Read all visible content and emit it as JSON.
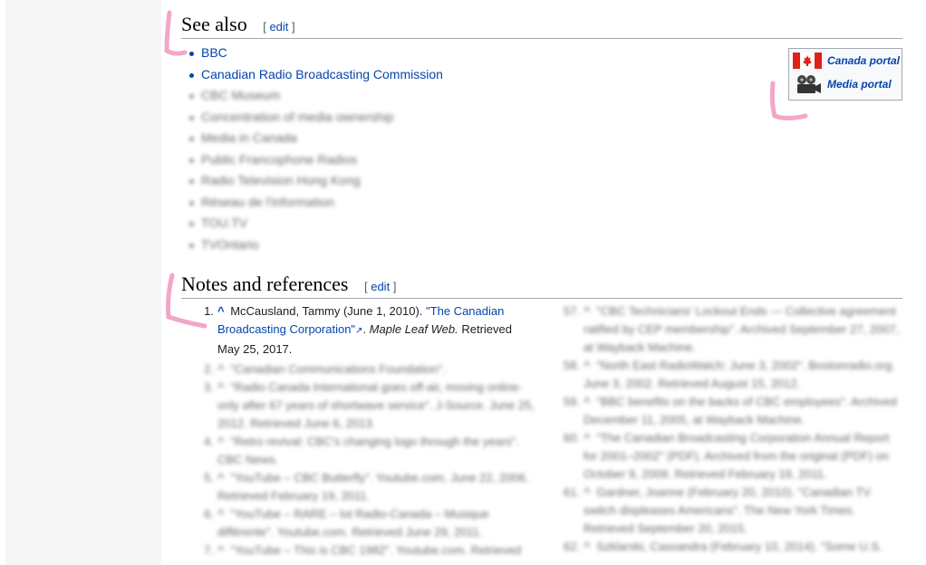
{
  "see_also": {
    "title": "See also",
    "edit_open": "[",
    "edit_label": "edit",
    "edit_close": "]",
    "items": [
      {
        "label": "BBC",
        "blurred": false
      },
      {
        "label": "Canadian Radio Broadcasting Commission",
        "blurred": false
      },
      {
        "label": "CBC Museum",
        "blurred": true
      },
      {
        "label": "Concentration of media ownership",
        "blurred": true
      },
      {
        "label": "Media in Canada",
        "blurred": true
      },
      {
        "label": "Public Francophone Radios",
        "blurred": true
      },
      {
        "label": "Radio Television Hong Kong",
        "blurred": true
      },
      {
        "label": "Réseau de l'information",
        "blurred": true
      },
      {
        "label": "TOU.TV",
        "blurred": true
      },
      {
        "label": "TVOntario",
        "blurred": true
      }
    ]
  },
  "portals": [
    {
      "label": "Canada portal",
      "icon": "canada-flag-icon"
    },
    {
      "label": "Media portal",
      "icon": "film-camera-icon"
    }
  ],
  "notes": {
    "title": "Notes and references",
    "edit_open": "[",
    "edit_label": "edit",
    "edit_close": "]",
    "first_ref": {
      "number": "1.",
      "caret": "^",
      "author": "McCausland, Tammy (June 1, 2010).",
      "title_link": "\"The Canadian Broadcasting Corporation\"",
      "source": "Maple Leaf Web.",
      "retrieved": "Retrieved May 25, 2017."
    },
    "left_blurred": [
      {
        "number": "2.",
        "text": "\"Canadian Communications Foundation\"."
      },
      {
        "number": "3.",
        "text": "\"Radio Canada International goes off-air, moving online-only after 67 years of shortwave service\". J-Source. June 25, 2012. Retrieved June 6, 2013."
      },
      {
        "number": "4.",
        "text": "\"Retro revival: CBC's changing logo through the years\". CBC News."
      },
      {
        "number": "5.",
        "text": "\"YouTube – CBC Butterfly\". Youtube.com. June 22, 2006. Retrieved February 19, 2011."
      },
      {
        "number": "6.",
        "text": "\"YouTube – RARE – lot Radio-Canada – Musique différente\". Youtube.com. Retrieved June 29, 2011."
      },
      {
        "number": "7.",
        "text": "\"YouTube – This is CBC 1982\". Youtube.com. Retrieved"
      }
    ],
    "right_blurred": [
      {
        "number": "57.",
        "text": "\"CBC Technicians' Lockout Ends — Collective agreement ratified by CEP membership\". Archived September 27, 2007, at Wayback Machine."
      },
      {
        "number": "58.",
        "text": "\"North East RadioWatch: June 3, 2002\". Bostonradio.org. June 3, 2002. Retrieved August 15, 2012."
      },
      {
        "number": "59.",
        "text": "\"BBC benefits on the backs of CBC employees\". Archived December 11, 2005, at Wayback Machine."
      },
      {
        "number": "60.",
        "text": "\"The Canadian Broadcasting Corporation Annual Report for 2001–2002\" (PDF). Archived from the original (PDF) on October 9, 2009. Retrieved February 19, 2011."
      },
      {
        "number": "61.",
        "text": "Gardner, Joanne (February 20, 2010). \"Canadian TV switch displeases Americans\". The New York Times. Retrieved September 20, 2015."
      },
      {
        "number": "62.",
        "text": "Szklarski, Cassandra (February 10, 2014). \"Some U.S."
      }
    ]
  },
  "colors": {
    "link": "#0645ad",
    "annotation": "#f3a6c8",
    "divider": "#a2a9b1"
  }
}
